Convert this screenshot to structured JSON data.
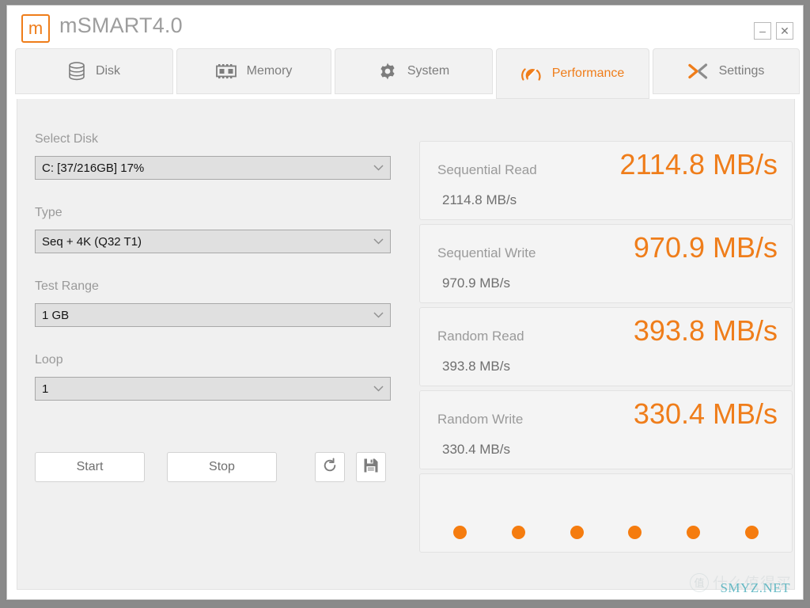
{
  "window": {
    "title": "mSMART4.0",
    "logo_glyph": "m",
    "minimize_label": "–",
    "close_label": "✕",
    "accent_color": "#ef7d1a",
    "label_color": "#9a9a9a"
  },
  "tabs": [
    {
      "label": "Disk",
      "icon": "database-icon",
      "active": false
    },
    {
      "label": "Memory",
      "icon": "memory-chip-icon",
      "active": false
    },
    {
      "label": "System",
      "icon": "gear-icon",
      "active": false
    },
    {
      "label": "Performance",
      "icon": "gauge-icon",
      "active": true
    },
    {
      "label": "Settings",
      "icon": "crossing-arrows-icon",
      "active": false
    }
  ],
  "form": {
    "fields": [
      {
        "label": "Select Disk",
        "value": "C: [37/216GB] 17%"
      },
      {
        "label": "Type",
        "value": "Seq + 4K (Q32 T1)"
      },
      {
        "label": "Test Range",
        "value": "1 GB"
      },
      {
        "label": "Loop",
        "value": "1"
      }
    ]
  },
  "actions": {
    "start_label": "Start",
    "stop_label": "Stop",
    "refresh_icon": "refresh-icon",
    "save_icon": "save-icon"
  },
  "results": [
    {
      "label": "Sequential Read",
      "value": "2114.8 MB/s",
      "detail": "2114.8 MB/s"
    },
    {
      "label": "Sequential Write",
      "value": "970.9 MB/s",
      "detail": "970.9 MB/s"
    },
    {
      "label": "Random Read",
      "value": "393.8 MB/s",
      "detail": "393.8 MB/s"
    },
    {
      "label": "Random Write",
      "value": "330.4 MB/s",
      "detail": "330.4 MB/s"
    }
  ],
  "progress": {
    "dot_count": 6,
    "dot_color": "#f57c0f"
  },
  "watermark": {
    "badge": "值",
    "text": "什么值得买",
    "url": "SMYZ.NET"
  }
}
